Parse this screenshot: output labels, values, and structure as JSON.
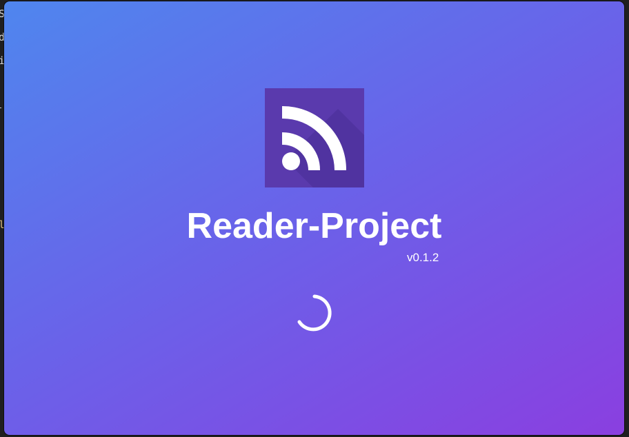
{
  "background_editor": {
    "lines": [
      "S",
      "d",
      "i",
      "",
      "",
      "",
      "",
      "",
      "",
      "l"
    ]
  },
  "splash": {
    "title": "Reader-Project",
    "version": "v0.1.2",
    "logo_icon": "rss-icon",
    "spinner_icon": "loading-spinner-icon",
    "colors": {
      "gradient_start": "#4f86ee",
      "gradient_mid": "#6a62e9",
      "gradient_end": "#8a3fe0",
      "logo_bg": "#5a3aad",
      "text": "#ffffff"
    }
  }
}
